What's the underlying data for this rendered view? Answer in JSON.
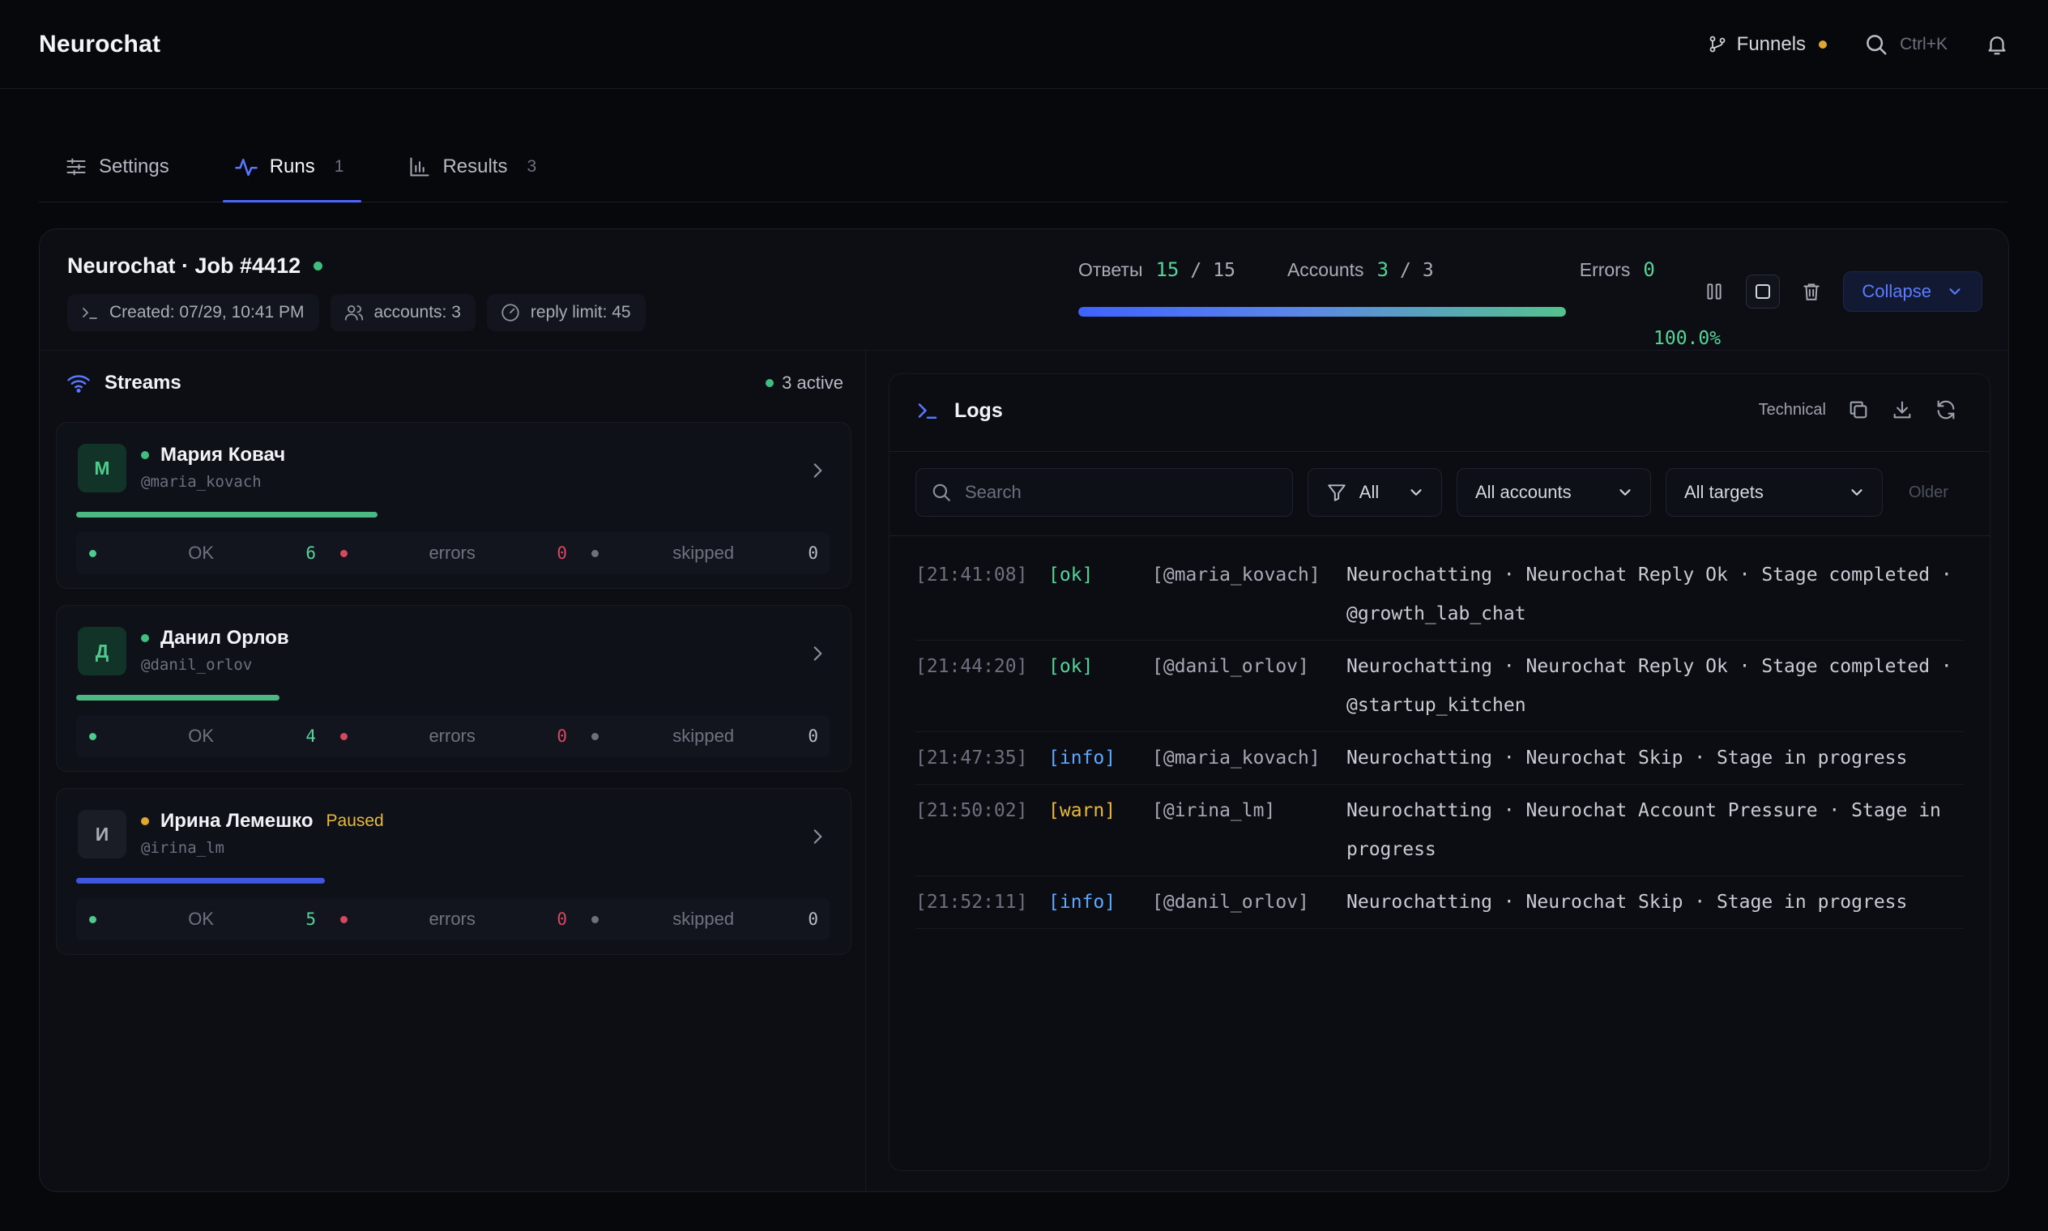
{
  "app": {
    "title": "Neurochat"
  },
  "topbar": {
    "funnels_label": "Funnels",
    "search_shortcut": "Ctrl+K",
    "status_color": "#e0a632"
  },
  "tabs": [
    {
      "label": "Settings",
      "count": "",
      "icon": "sliders-icon"
    },
    {
      "label": "Runs",
      "count": "1",
      "icon": "activity-icon",
      "active": true
    },
    {
      "label": "Results",
      "count": "3",
      "icon": "bar-chart-icon"
    }
  ],
  "job": {
    "title": "Neurochat · Job #4412",
    "status_color": "#3fbf7f",
    "chips": {
      "created": "Created: 07/29, 10:41 PM",
      "accounts": "accounts: 3",
      "reply_limit": "reply limit: 45"
    },
    "stats": {
      "answers_label": "Ответы",
      "answers_done": "15",
      "answers_total": "15",
      "accounts_label": "Accounts",
      "accounts_done": "3",
      "accounts_total": "3",
      "errors_label": "Errors",
      "errors_value": "0",
      "slash": "/",
      "percent": "100.0%",
      "progress": 1.0
    },
    "collapse_label": "Collapse"
  },
  "streams": {
    "title": "Streams",
    "active_label": "3 active",
    "labels": {
      "ok": "OK",
      "errors": "errors",
      "skipped": "skipped"
    },
    "items": [
      {
        "initial": "М",
        "name": "Мария Ковач",
        "handle": "@maria_kovach",
        "status": "",
        "ok": "6",
        "errors": "0",
        "skipped": "0",
        "progress": 0.4,
        "status_color": "#3fbf7f",
        "bar_color": "#4cb883"
      },
      {
        "initial": "Д",
        "name": "Данил Орлов",
        "handle": "@danil_orlov",
        "status": "",
        "ok": "4",
        "errors": "0",
        "skipped": "0",
        "progress": 0.27,
        "status_color": "#3fbf7f",
        "bar_color": "#4cb883"
      },
      {
        "initial": "И",
        "name": "Ирина Лемешко",
        "handle": "@irina_lm",
        "status": "Paused",
        "ok": "5",
        "errors": "0",
        "skipped": "0",
        "progress": 0.33,
        "status_color": "#e0a632",
        "bar_color": "#3f57e0"
      }
    ]
  },
  "logs": {
    "title": "Logs",
    "technical_label": "Technical",
    "search_placeholder": "Search",
    "filter_level": "All",
    "filter_accounts": "All accounts",
    "filter_targets": "All targets",
    "older_label": "Older",
    "entries": [
      {
        "time": "[21:41:08]",
        "level": "[ok]",
        "account": "[@maria_kovach]",
        "message": "Neurochatting · Neurochat Reply Ok · Stage completed · @growth_lab_chat",
        "level_color": "#55d49a"
      },
      {
        "time": "[21:44:20]",
        "level": "[ok]",
        "account": "[@danil_orlov]",
        "message": "Neurochatting · Neurochat Reply Ok · Stage completed · @startup_kitchen",
        "level_color": "#55d49a"
      },
      {
        "time": "[21:47:35]",
        "level": "[info]",
        "account": "[@maria_kovach]",
        "message": "Neurochatting · Neurochat Skip · Stage in progress",
        "level_color": "#5fa8ff"
      },
      {
        "time": "[21:50:02]",
        "level": "[warn]",
        "account": "[@irina_lm]",
        "message": "Neurochatting · Neurochat Account Pressure · Stage in progress",
        "level_color": "#e8b93a"
      },
      {
        "time": "[21:52:11]",
        "level": "[info]",
        "account": "[@danil_orlov]",
        "message": "Neurochatting · Neurochat Skip · Stage in progress",
        "level_color": "#5fa8ff"
      }
    ]
  }
}
